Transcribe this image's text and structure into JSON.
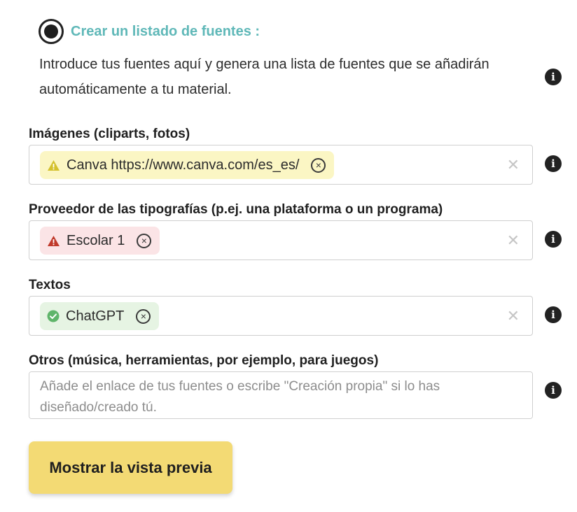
{
  "section": {
    "title": "Crear un listado de fuentes :",
    "selected": true,
    "intro": "Introduce tus fuentes aquí y genera una lista de fuentes que se añadirán automáticamente a tu material."
  },
  "fields": {
    "images": {
      "label": "Imágenes (cliparts, fotos)",
      "tag": {
        "text": "Canva https://www.canva.com/es_es/",
        "status": "warning",
        "color": "#fbf6c4"
      }
    },
    "fonts": {
      "label": "Proveedor de las tipografías (p.ej. una plataforma o un programa)",
      "tag": {
        "text": "Escolar 1",
        "status": "error",
        "color": "#fbe4e6"
      }
    },
    "texts": {
      "label": "Textos",
      "tag": {
        "text": "ChatGPT",
        "status": "success",
        "color": "#e6f4e3"
      }
    },
    "others": {
      "label": "Otros (música, herramientas, por ejemplo, para juegos)",
      "placeholder": "Añade el enlace de tus fuentes o escribe \"Creación propia\" si lo has diseñado/creado tú.",
      "value": ""
    }
  },
  "icons": {
    "info": "info-icon",
    "clear": "clear-x-icon",
    "remove_tag": "remove-circle-x-icon",
    "warning": "warning-triangle-icon",
    "error": "error-triangle-icon",
    "success": "check-circle-icon"
  },
  "colors": {
    "accent_title": "#5fb8b8",
    "button_bg": "#f3da74",
    "warning_icon": "#d4c12c",
    "error_icon": "#c0392b",
    "success_icon": "#5fb56a"
  },
  "buttons": {
    "preview_label": "Mostrar la vista previa"
  }
}
